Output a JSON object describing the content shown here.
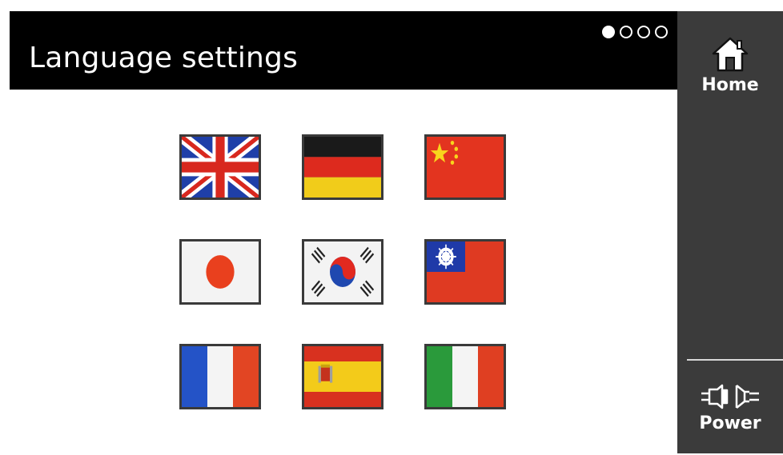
{
  "header": {
    "title": "Language settings",
    "page_indicator": {
      "total": 4,
      "current": 1
    }
  },
  "sidebar": {
    "home": {
      "label": "Home",
      "icon": "home-icon"
    },
    "power": {
      "label": "Power",
      "icon": "power-plug-icon"
    }
  },
  "languages": [
    {
      "name": "english",
      "icon": "uk-flag-icon"
    },
    {
      "name": "german",
      "icon": "germany-flag-icon"
    },
    {
      "name": "chinese",
      "icon": "china-flag-icon"
    },
    {
      "name": "japanese",
      "icon": "japan-flag-icon"
    },
    {
      "name": "korean",
      "icon": "south-korea-flag-icon"
    },
    {
      "name": "traditional-chinese",
      "icon": "taiwan-flag-icon"
    },
    {
      "name": "french",
      "icon": "france-flag-icon"
    },
    {
      "name": "spanish",
      "icon": "spain-flag-icon"
    },
    {
      "name": "italian",
      "icon": "italy-flag-icon"
    }
  ],
  "colors": {
    "titlebar": "#000000",
    "sidebar": "#3b3b3b",
    "content": "#ffffff"
  }
}
